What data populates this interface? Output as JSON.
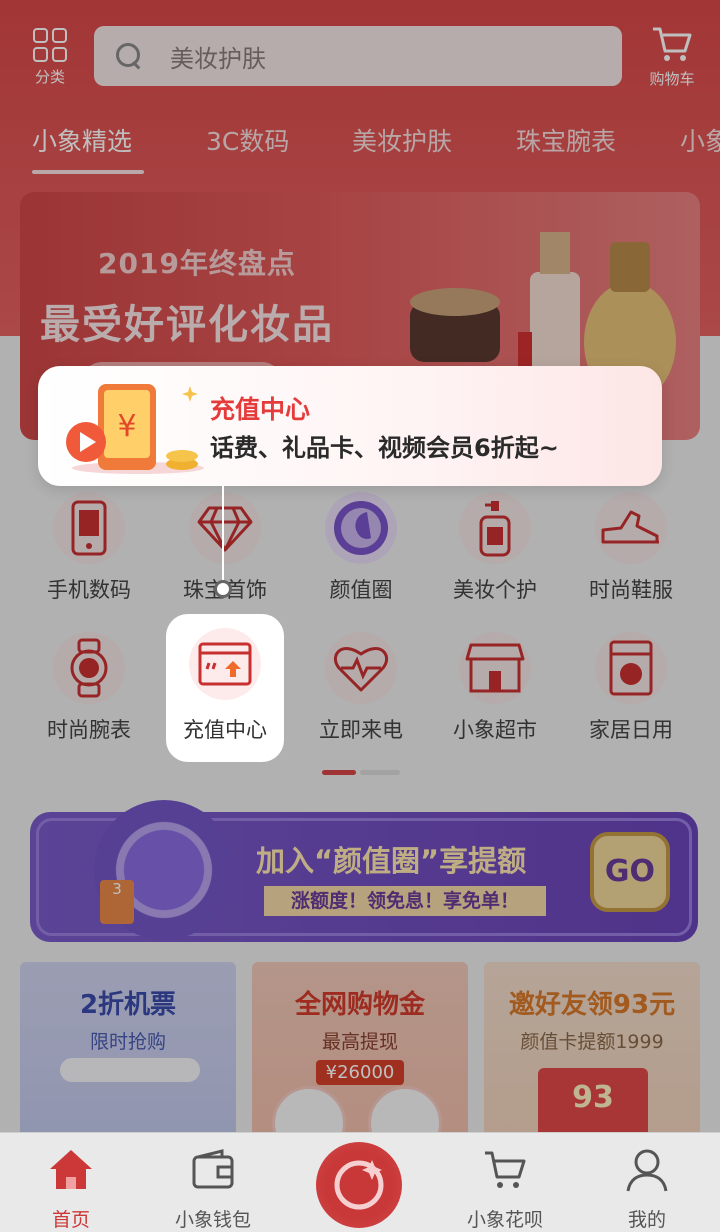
{
  "header": {
    "category_label": "分类",
    "search_placeholder": "美妆护肤",
    "cart_label": "购物车"
  },
  "tabs": [
    {
      "label": "小象精选",
      "active": true
    },
    {
      "label": "3C数码"
    },
    {
      "label": "美妆护肤"
    },
    {
      "label": "珠宝腕表"
    },
    {
      "label": "小象"
    }
  ],
  "banner": {
    "year_text": "2019年终盘点",
    "title": "最受好评化妆品"
  },
  "tooltip": {
    "title": "充值中心",
    "description": "话费、礼品卡、视频会员6折起~",
    "icon": "phone-recharge-illustration"
  },
  "menu": {
    "row1": [
      {
        "label": "手机数码",
        "icon": "phone-icon"
      },
      {
        "label": "珠宝首饰",
        "icon": "diamond-icon"
      },
      {
        "label": "颜值圈",
        "icon": "face-icon"
      },
      {
        "label": "美妆个护",
        "icon": "lotion-icon"
      },
      {
        "label": "时尚鞋服",
        "icon": "shoe-icon"
      }
    ],
    "row2": [
      {
        "label": "时尚腕表",
        "icon": "watch-icon"
      },
      {
        "label": "充值中心",
        "icon": "recharge-icon"
      },
      {
        "label": "立即来电",
        "icon": "heartbeat-icon"
      },
      {
        "label": "小象超市",
        "icon": "store-icon"
      },
      {
        "label": "家居日用",
        "icon": "washer-icon"
      }
    ]
  },
  "promo": {
    "title": "加入“颜值圈”享提额",
    "subtitle": "涨额度！领免息！享免单！",
    "go_label": "GO",
    "badge": "3"
  },
  "cards": [
    {
      "title": "2折机票",
      "subtitle": "限时抢购"
    },
    {
      "title": "全网购物金",
      "subtitle": "最高提现",
      "price": "¥26000"
    },
    {
      "title": "邀好友领93元",
      "subtitle": "颜值卡提额1999",
      "amount": "93"
    }
  ],
  "bottom_nav": [
    {
      "label": "首页",
      "icon": "home-icon",
      "active": true
    },
    {
      "label": "小象钱包",
      "icon": "wallet-icon"
    },
    {
      "label": "",
      "icon": "center-circle-icon"
    },
    {
      "label": "小象花呗",
      "icon": "cart-icon"
    },
    {
      "label": "我的",
      "icon": "user-icon"
    }
  ],
  "colors": {
    "brand_red": "#d94848",
    "accent_text": "#e53b3b",
    "promo_purple": "#6a44b8"
  }
}
